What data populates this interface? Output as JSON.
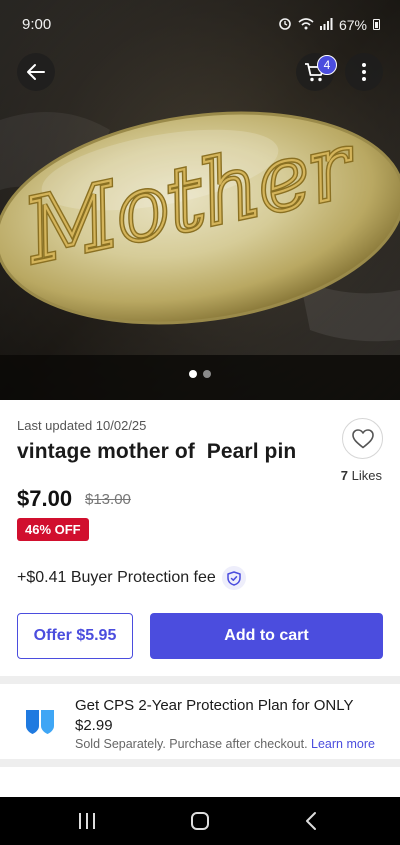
{
  "status_bar": {
    "time": "9:00",
    "battery": "67%"
  },
  "header": {
    "cart_count": "4"
  },
  "gallery": {
    "image_alt": "Mother pearl pin",
    "image_count": 2,
    "active_index": 0,
    "pin_text": "Mother"
  },
  "product": {
    "last_updated": "Last updated 10/02/25",
    "title": "vintage mother of  Pearl pin",
    "likes_count": "7",
    "likes_label": " Likes",
    "price": "$7.00",
    "original_price": "$13.00",
    "discount": "46% OFF",
    "buyer_fee": "+$0.41 Buyer Protection fee"
  },
  "actions": {
    "offer_label": "Offer $5.95",
    "add_to_cart_label": "Add to cart"
  },
  "protection_plan": {
    "title": "Get CPS 2-Year Protection Plan for ONLY",
    "price": "$2.99",
    "subtitle": "Sold Separately. Purchase after checkout.",
    "learn_more": "Learn more"
  },
  "colors": {
    "accent": "#4b4dde",
    "discount_bg": "#d10f2e",
    "shield_blue": "#1f7ae0"
  }
}
